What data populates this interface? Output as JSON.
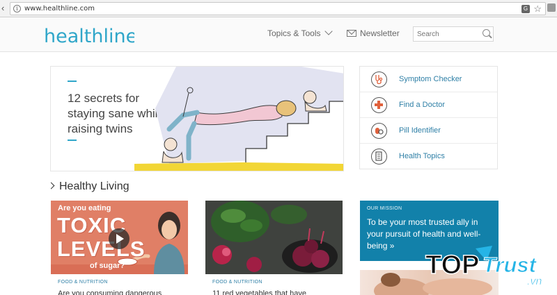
{
  "browser": {
    "url": "www.healthline.com"
  },
  "header": {
    "logo_text": "healthline",
    "topics_label": "Topics & Tools",
    "newsletter_label": "Newsletter",
    "search_placeholder": "Search"
  },
  "hero": {
    "title": "12 secrets for staying sane while raising twins"
  },
  "quick_links": [
    {
      "label": "Symptom Checker",
      "icon": "stethoscope-icon"
    },
    {
      "label": "Find a Doctor",
      "icon": "medical-cross-icon"
    },
    {
      "label": "Pill Identifier",
      "icon": "pill-icon"
    },
    {
      "label": "Health Topics",
      "icon": "document-icon"
    }
  ],
  "section": {
    "title": "Healthy Living"
  },
  "cards": [
    {
      "image_text_question": "Are you eating",
      "image_text_line1": "TOXIC",
      "image_text_line2": "LEVELS",
      "image_text_line3": "of sugar?",
      "category": "FOOD & NUTRITION",
      "headline": "Are you consuming dangerous"
    },
    {
      "category": "FOOD & NUTRITION",
      "headline": "11 red vegetables that have"
    }
  ],
  "mission": {
    "tag": "OUR MISSION",
    "text": "To be your most trusted ally in your pursuit of health and well-being »"
  },
  "watermark": {
    "line1": "TOP",
    "line2": "Trust",
    "line3": ".vn"
  },
  "colors": {
    "brand": "#2fa6c9",
    "link": "#2e7fa6",
    "mission_bg": "#1281aa",
    "toxic_bg": "#e07f66"
  }
}
